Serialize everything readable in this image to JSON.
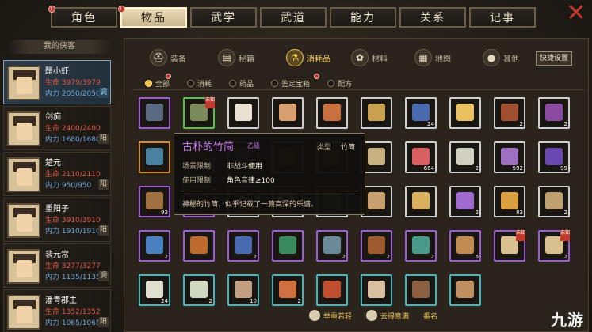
{
  "top_tabs": [
    {
      "label": "角色",
      "badge": "!"
    },
    {
      "label": "物品",
      "badge": "!",
      "active": true
    },
    {
      "label": "武学"
    },
    {
      "label": "武道"
    },
    {
      "label": "能力"
    },
    {
      "label": "关系"
    },
    {
      "label": "记事"
    }
  ],
  "close_label": "✕",
  "roster": {
    "title": "我的侠客",
    "characters": [
      {
        "name": "醋小虾",
        "hp": "生命 3979/3979",
        "mp": "内力 2050/2050",
        "tag": "调",
        "active": true
      },
      {
        "name": "剑痴",
        "hp": "生命 2400/2400",
        "mp": "内力 1680/1680",
        "tag": "阳"
      },
      {
        "name": "楚元",
        "hp": "生命 2110/2110",
        "mp": "内力 950/950",
        "tag": "阳"
      },
      {
        "name": "重阳子",
        "hp": "生命 3910/3910",
        "mp": "内力 1910/1910",
        "tag": "阳"
      },
      {
        "name": "裴元常",
        "hp": "生命 3277/3277",
        "mp": "内力 1135/1135",
        "tag": "调"
      },
      {
        "name": "潘青郡主",
        "hp": "生命 1352/1352",
        "mp": "内力 1065/1065",
        "tag": "阳"
      }
    ]
  },
  "categories": [
    {
      "label": "装备",
      "icon": "helmet-icon"
    },
    {
      "label": "秘籍",
      "icon": "book-icon"
    },
    {
      "label": "消耗品",
      "icon": "potion-icon",
      "active": true
    },
    {
      "label": "材料",
      "icon": "herb-icon"
    },
    {
      "label": "地图",
      "icon": "map-icon"
    },
    {
      "label": "其他",
      "icon": "misc-icon"
    }
  ],
  "quick_button": "快捷设置",
  "filters": [
    {
      "label": "全部",
      "active": true,
      "badge": true
    },
    {
      "label": "消耗"
    },
    {
      "label": "药品"
    },
    {
      "label": "鉴定宝箱",
      "badge": true
    },
    {
      "label": "配方"
    }
  ],
  "tooltip": {
    "name": "古朴的竹简",
    "grade": "乙级",
    "type_label": "类型",
    "type_value": "竹简",
    "scene_label": "场景限制",
    "scene_value": "非战斗使用",
    "use_label": "使用限制",
    "use_value": "角色音律≥100",
    "description": "神秘的竹简，似乎记载了一篇高深的乐谱。"
  },
  "items": [
    {
      "q": "purple",
      "color": "#5a6a80",
      "count": ""
    },
    {
      "q": "green",
      "color": "#7a8a5a",
      "count": "",
      "unknown": "未知"
    },
    {
      "q": "white",
      "color": "#e8e0d0",
      "count": ""
    },
    {
      "q": "white",
      "color": "#d8a070",
      "count": ""
    },
    {
      "q": "white",
      "color": "#c87040",
      "count": ""
    },
    {
      "q": "white",
      "color": "#c8a050",
      "count": ""
    },
    {
      "q": "white",
      "color": "#4a6ab0",
      "count": "24"
    },
    {
      "q": "white",
      "color": "#e8c060",
      "count": ""
    },
    {
      "q": "white",
      "color": "#a05030",
      "count": "2"
    },
    {
      "q": "white",
      "color": "#8a4aa0",
      "count": "2"
    },
    {
      "q": "orange",
      "color": "#4a80a0",
      "count": ""
    },
    {
      "q": "purple",
      "color": "#8a6a40",
      "count": ""
    },
    {
      "q": "white",
      "color": "#6a6a6a",
      "count": ""
    },
    {
      "q": "white",
      "color": "#7a6040",
      "count": ""
    },
    {
      "q": "white",
      "color": "#8a7040",
      "count": ""
    },
    {
      "q": "white",
      "color": "#c8b080",
      "count": ""
    },
    {
      "q": "white",
      "color": "#d86060",
      "count": "664"
    },
    {
      "q": "white",
      "color": "#d0d0c0",
      "count": "2"
    },
    {
      "q": "white",
      "color": "#a070c0",
      "count": "592"
    },
    {
      "q": "white",
      "color": "#6a4ab0",
      "count": "99"
    },
    {
      "q": "purple",
      "color": "#a07040",
      "count": "93"
    },
    {
      "q": "purple",
      "color": "#8a6040",
      "count": ""
    },
    {
      "q": "white",
      "color": "#6a5a40",
      "count": ""
    },
    {
      "q": "white",
      "color": "#7a6a50",
      "count": ""
    },
    {
      "q": "white",
      "color": "#8a7a60",
      "count": ""
    },
    {
      "q": "white",
      "color": "#c8a070",
      "count": ""
    },
    {
      "q": "white",
      "color": "#d8b060",
      "count": ""
    },
    {
      "q": "white",
      "color": "#a06ad0",
      "count": "2"
    },
    {
      "q": "white",
      "color": "#d8a040",
      "count": "83"
    },
    {
      "q": "white",
      "color": "#c0a070",
      "count": "2"
    },
    {
      "q": "purple",
      "color": "#4a80c0",
      "count": "2"
    },
    {
      "q": "purple",
      "color": "#c06a30",
      "count": ""
    },
    {
      "q": "purple",
      "color": "#4a6ab0",
      "count": "2"
    },
    {
      "q": "purple",
      "color": "#3a8a60",
      "count": ""
    },
    {
      "q": "purple",
      "color": "#6a8a9a",
      "count": "2"
    },
    {
      "q": "purple",
      "color": "#a05a30",
      "count": "2"
    },
    {
      "q": "purple",
      "color": "#4a9a8a",
      "count": "2"
    },
    {
      "q": "purple",
      "color": "#c08a50",
      "count": "6"
    },
    {
      "q": "purple",
      "color": "#d8c090",
      "count": "",
      "unknown": "未知"
    },
    {
      "q": "purple",
      "color": "#d8c090",
      "count": "2",
      "unknown": "未知"
    },
    {
      "q": "teal",
      "color": "#e0e0d0",
      "count": "24"
    },
    {
      "q": "teal",
      "color": "#d0d8c0",
      "count": "2"
    },
    {
      "q": "teal",
      "color": "#c0a080",
      "count": "10"
    },
    {
      "q": "teal",
      "color": "#d07040",
      "count": "2"
    },
    {
      "q": "teal",
      "color": "#c05030",
      "count": ""
    },
    {
      "q": "teal",
      "color": "#d8c0a0",
      "count": ""
    },
    {
      "q": "teal",
      "color": "#8a6040",
      "count": ""
    },
    {
      "q": "teal",
      "color": "#c09060",
      "count": ""
    }
  ],
  "bottom": [
    {
      "label": "举重若轻",
      "icon": "weight-icon"
    },
    {
      "label": "去得意满",
      "icon": "mood-icon"
    },
    {
      "label": "番名"
    }
  ],
  "watermark": "九游"
}
